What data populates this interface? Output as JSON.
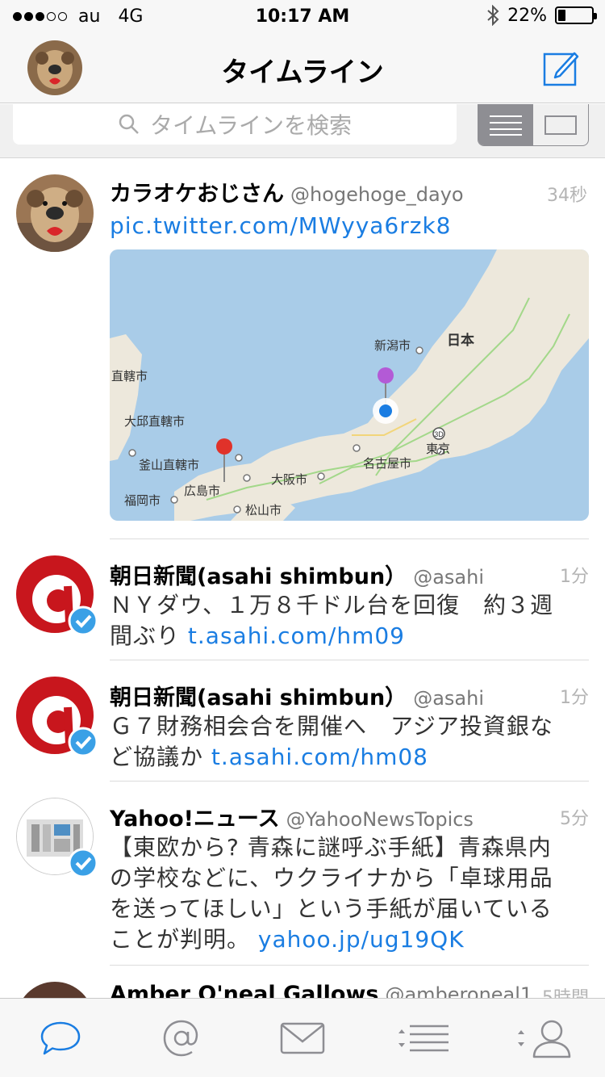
{
  "status_bar": {
    "carrier": "au",
    "network": "4G",
    "time": "10:17 AM",
    "battery": "22%",
    "battery_level": 0.22
  },
  "nav": {
    "title": "タイムライン"
  },
  "search": {
    "placeholder": "タイムラインを検索"
  },
  "tweets": [
    {
      "name": "カラオケおじさん",
      "handle": "@hogehoge_dayo",
      "time": "34秒",
      "link": "pic.twitter.com/MWyya6rzk8",
      "map_labels": [
        "日本",
        "新潟市",
        "直轄市",
        "大邱直轄市",
        "釜山直轄市",
        "広島市",
        "福岡市",
        "松山市",
        "大阪市",
        "名古屋市",
        "東京",
        "3D"
      ]
    },
    {
      "name": "朝日新聞(asahi shimbun）",
      "handle": "@asahi",
      "time": "1分",
      "text": "ＮＹダウ、１万８千ドル台を回復　約３週間ぶり ",
      "link": "t.asahi.com/hm09"
    },
    {
      "name": "朝日新聞(asahi shimbun）",
      "handle": "@asahi",
      "time": "1分",
      "text": "Ｇ７財務相会合を開催へ　アジア投資銀など協議か ",
      "link": "t.asahi.com/hm08"
    },
    {
      "name": "Yahoo!ニュース",
      "handle": "@YahooNewsTopics",
      "time": "5分",
      "text": "【東欧から? 青森に謎呼ぶ手紙】青森県内の学校などに、ウクライナから「卓球用品を送ってほしい」という手紙が届いていることが判明。 ",
      "link": "yahoo.jp/ug19QK"
    },
    {
      "name": "Amber O'neal Gallows",
      "handle": "@amberoneal1",
      "time": "5時間"
    }
  ],
  "icons": {
    "timeline_tab": "speech-bubble-icon",
    "mentions_tab": "at-sign-icon",
    "messages_tab": "envelope-icon",
    "lists_tab": "list-icon",
    "profile_tab": "person-icon"
  },
  "colors": {
    "accent": "#1a7de2",
    "asahi_red": "#c8161d",
    "verified": "#3aa0e6"
  }
}
